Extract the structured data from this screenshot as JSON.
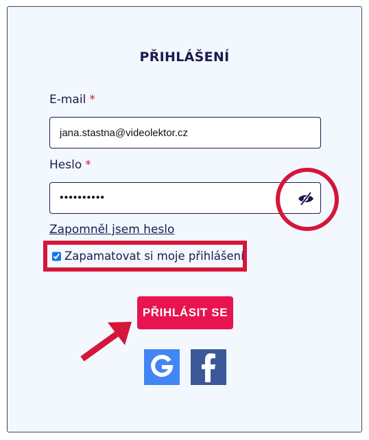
{
  "form": {
    "title": "PŘIHLÁŠENÍ",
    "email": {
      "label": "E-mail",
      "required_mark": "*",
      "value": "jana.stastna@videolektor.cz"
    },
    "password": {
      "label": "Heslo",
      "required_mark": "*",
      "value": "••••••••••",
      "toggle_icon": "eye-slash-icon"
    },
    "forgot_link": "Zapomněl jsem heslo",
    "remember": {
      "label": "Zapamatovat si moje přihlášení",
      "checked": true
    },
    "submit_label": "PŘIHLÁSIT SE",
    "social": [
      {
        "provider": "google",
        "icon": "google-icon",
        "glyph": "G"
      },
      {
        "provider": "facebook",
        "icon": "facebook-icon",
        "glyph": "f"
      }
    ]
  },
  "colors": {
    "card_bg": "#f2f8fe",
    "text": "#1d1a4f",
    "accent": "#e8144f",
    "highlight": "#d5163a",
    "google": "#4285f4",
    "facebook": "#3b5998"
  }
}
